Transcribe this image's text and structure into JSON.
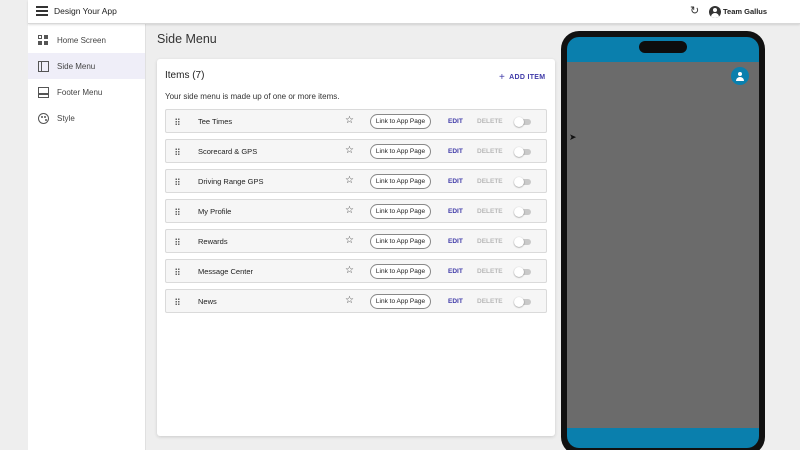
{
  "app": {
    "title": "Design Your App"
  },
  "header": {
    "refresh_icon": "↻",
    "account_icon": "account-circle-icon",
    "team_name": "Team Gallus"
  },
  "sidebar": {
    "items": [
      {
        "label": "Home Screen",
        "icon": "grid-icon",
        "active": false
      },
      {
        "label": "Side Menu",
        "icon": "side-menu-icon",
        "active": true
      },
      {
        "label": "Footer Menu",
        "icon": "footer-menu-icon",
        "active": false
      },
      {
        "label": "Style",
        "icon": "palette-icon",
        "active": false
      }
    ],
    "active_bg": "#efeef8"
  },
  "main": {
    "page_title": "Side Menu",
    "items_title": "Items (7)",
    "add_item_label": "ADD ITEM",
    "add_item_plus": "+",
    "description": "Your side menu is made up of one or more items.",
    "rows": [
      {
        "label": "Tee Times",
        "link_label": "Link to App Page",
        "edit_label": "EDIT",
        "delete_label": "DELETE",
        "star": "☆",
        "enabled": false
      },
      {
        "label": "Scorecard & GPS",
        "link_label": "Link to App Page",
        "edit_label": "EDIT",
        "delete_label": "DELETE",
        "star": "☆",
        "enabled": false
      },
      {
        "label": "Driving Range GPS",
        "link_label": "Link to App Page",
        "edit_label": "EDIT",
        "delete_label": "DELETE",
        "star": "☆",
        "enabled": false
      },
      {
        "label": "My Profile",
        "link_label": "Link to App Page",
        "edit_label": "EDIT",
        "delete_label": "DELETE",
        "star": "☆",
        "enabled": false
      },
      {
        "label": "Rewards",
        "link_label": "Link to App Page",
        "edit_label": "EDIT",
        "delete_label": "DELETE",
        "star": "☆",
        "enabled": false
      },
      {
        "label": "Message Center",
        "link_label": "Link to App Page",
        "edit_label": "EDIT",
        "delete_label": "DELETE",
        "star": "☆",
        "enabled": false
      },
      {
        "label": "News",
        "link_label": "Link to App Page",
        "edit_label": "EDIT",
        "delete_label": "DELETE",
        "star": "☆",
        "enabled": false
      }
    ]
  },
  "preview": {
    "accent_color": "#0a7fad",
    "screen_color": "#6b6b6b",
    "profile_icon": "profile-icon"
  },
  "colors": {
    "primary": "#3f3aa8",
    "disabled": "#b8b8b8"
  }
}
